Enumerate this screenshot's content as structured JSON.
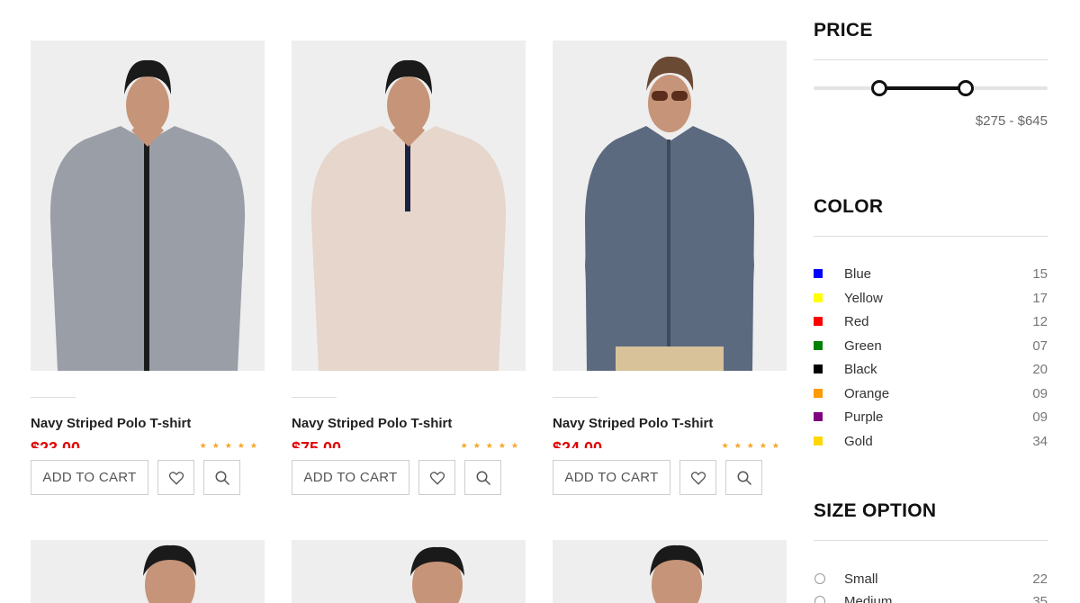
{
  "products": [
    {
      "name": "Navy Striped Polo T-shirt",
      "price": "$23.00",
      "add_to_cart": "ADD TO CART",
      "rating": 5,
      "stars": "★★★★★",
      "shirt_color": "#9a9ea6",
      "trim_color": "#1b1b1b"
    },
    {
      "name": "Navy Striped Polo T-shirt",
      "price": "$75.00",
      "add_to_cart": "ADD TO CART",
      "rating": 5,
      "stars": "★★★★★",
      "shirt_color": "#e6d6cb",
      "trim_color": "#1c2340"
    },
    {
      "name": "Navy Striped Polo T-shirt",
      "price": "$24.00",
      "add_to_cart": "ADD TO CART",
      "rating": 5,
      "stars": "★★★★★",
      "shirt_color": "#5c6a80",
      "trim_color": "#3e4a5c"
    }
  ],
  "filters": {
    "price": {
      "title": "PRICE",
      "range_label": "$275 - $645",
      "handle_low_fraction": 0.28,
      "handle_high_fraction": 0.65
    },
    "color": {
      "title": "COLOR",
      "items": [
        {
          "label": "Blue",
          "count": "15",
          "swatch": "#0000ff"
        },
        {
          "label": "Yellow",
          "count": "17",
          "swatch": "#ffff00"
        },
        {
          "label": "Red",
          "count": "12",
          "swatch": "#ff0000"
        },
        {
          "label": "Green",
          "count": "07",
          "swatch": "#008000"
        },
        {
          "label": "Black",
          "count": "20",
          "swatch": "#000000"
        },
        {
          "label": "Orange",
          "count": "09",
          "swatch": "#ff9900"
        },
        {
          "label": "Purple",
          "count": "09",
          "swatch": "#800080"
        },
        {
          "label": "Gold",
          "count": "34",
          "swatch": "#ffd700"
        }
      ]
    },
    "size": {
      "title": "SIZE OPTION",
      "items": [
        {
          "label": "Small",
          "count": "22"
        },
        {
          "label": "Medium",
          "count": "35"
        }
      ]
    }
  },
  "icons": {
    "wishlist": "heart-icon",
    "quick_view": "search-icon"
  },
  "colors": {
    "price": "#e00000",
    "star": "#f5a623",
    "accent": "#111111"
  }
}
